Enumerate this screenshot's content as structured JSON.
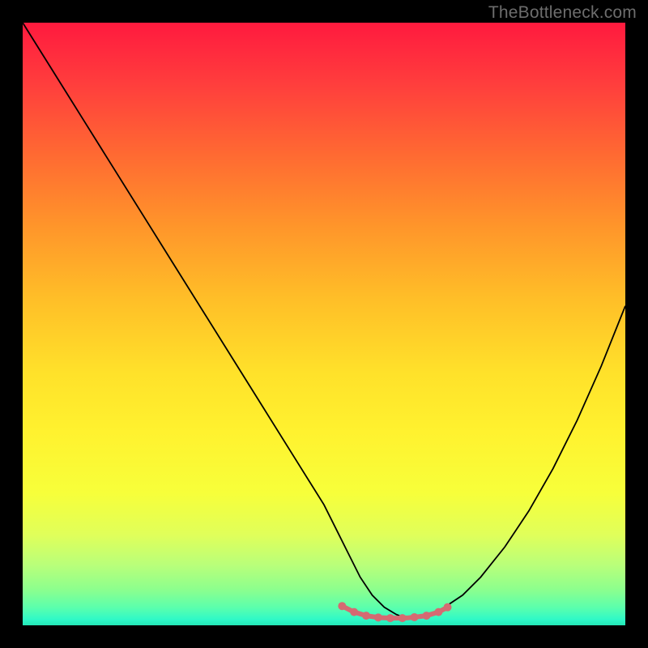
{
  "watermark": "TheBottleneck.com",
  "chart_data": {
    "type": "line",
    "title": "",
    "xlabel": "",
    "ylabel": "",
    "xlim": [
      0,
      100
    ],
    "ylim": [
      0,
      100
    ],
    "grid": false,
    "series": [
      {
        "name": "curve",
        "color": "#000000",
        "x": [
          0,
          5,
          10,
          15,
          20,
          25,
          30,
          35,
          40,
          45,
          50,
          52,
          54,
          56,
          58,
          60,
          62,
          63,
          64,
          66,
          68,
          70,
          73,
          76,
          80,
          84,
          88,
          92,
          96,
          100
        ],
        "values": [
          100,
          92,
          84,
          76,
          68,
          60,
          52,
          44,
          36,
          28,
          20,
          16,
          12,
          8,
          5,
          3,
          1.8,
          1.4,
          1.3,
          1.4,
          2,
          3,
          5,
          8,
          13,
          19,
          26,
          34,
          43,
          53
        ]
      },
      {
        "name": "highlight",
        "color": "#d56a72",
        "x": [
          53,
          55,
          57,
          59,
          61,
          63,
          64,
          65,
          67,
          69,
          70.5
        ],
        "values": [
          3.2,
          2.2,
          1.6,
          1.3,
          1.2,
          1.2,
          1.25,
          1.35,
          1.6,
          2.2,
          3.0
        ]
      }
    ],
    "highlight_markers": {
      "x": [
        53,
        55,
        57,
        59,
        61,
        63,
        65,
        67,
        69,
        70.5
      ],
      "values": [
        3.2,
        2.2,
        1.6,
        1.3,
        1.2,
        1.2,
        1.35,
        1.6,
        2.2,
        3.0
      ]
    }
  }
}
